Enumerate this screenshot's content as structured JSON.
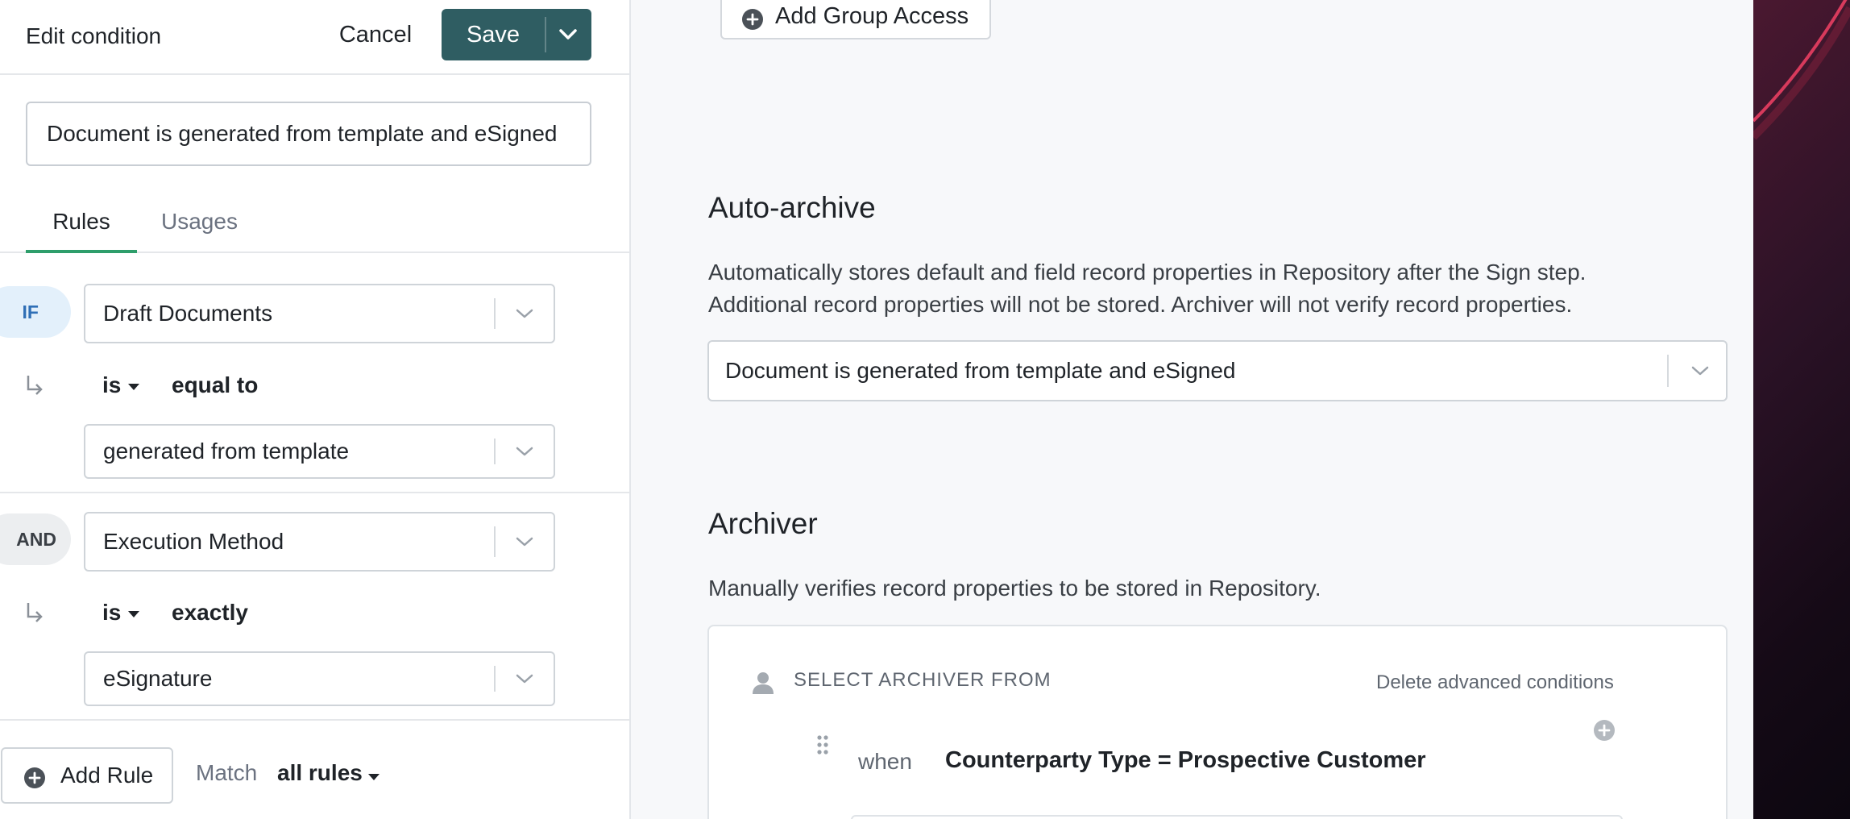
{
  "panel": {
    "title": "Edit condition",
    "cancel_label": "Cancel",
    "save_label": "Save",
    "condition_name": "Document is generated from template and eSigned",
    "tabs": [
      {
        "label": "Rules",
        "active": true
      },
      {
        "label": "Usages",
        "active": false
      }
    ],
    "rules": [
      {
        "connector": "IF",
        "field": "Draft Documents",
        "operator": "is",
        "comparison": "equal to",
        "value": "generated from template"
      },
      {
        "connector": "AND",
        "field": "Execution Method",
        "operator": "is",
        "comparison": "exactly",
        "value": "eSignature"
      }
    ],
    "add_rule_label": "Add Rule",
    "match_label": "Match",
    "match_value": "all rules"
  },
  "main": {
    "add_group_access_label": "Add Group Access",
    "auto_archive": {
      "heading": "Auto-archive",
      "description_line1": "Automatically stores default and field record properties in Repository after the Sign step.",
      "description_line2": "Additional record properties will not be stored. Archiver will not verify record properties.",
      "selected_condition": "Document is generated from template and eSigned"
    },
    "archiver": {
      "heading": "Archiver",
      "description": "Manually verifies record properties to be stored in Repository.",
      "select_from_label": "SELECT ARCHIVER FROM",
      "delete_label": "Delete advanced conditions",
      "when_label": "when",
      "condition": "Counterparty Type = Prospective Customer"
    }
  },
  "colors": {
    "save_button": "#2f5d62",
    "active_tab_underline": "#2e9e6b",
    "if_badge_bg": "#e3f0fb",
    "if_badge_text": "#2f6fb6"
  },
  "icons": [
    "chevron-down-icon",
    "plus-circle-icon",
    "subdirectory-arrow-icon",
    "caret-down-icon",
    "person-icon",
    "drag-handle-icon"
  ]
}
